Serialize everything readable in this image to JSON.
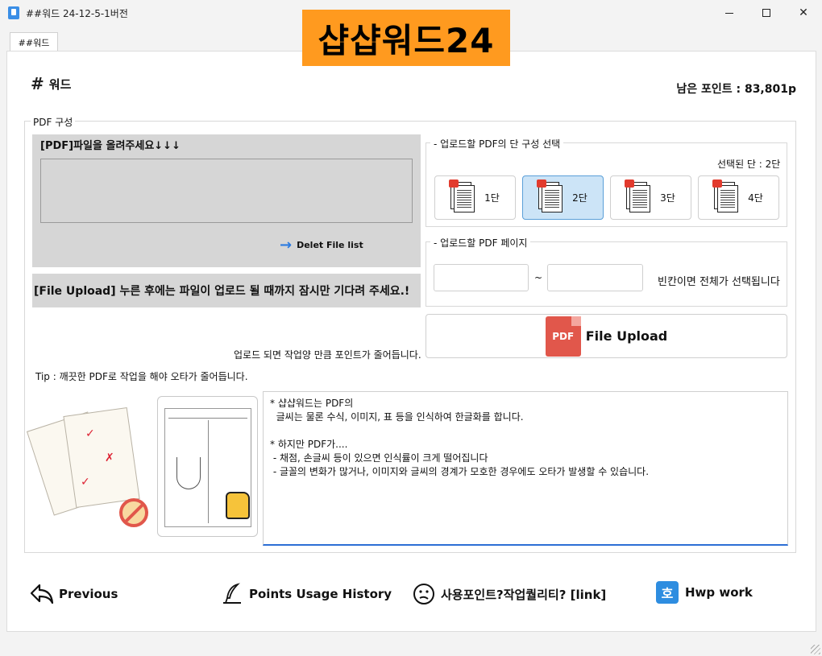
{
  "window": {
    "title": "##워드 24-12-5-1버전"
  },
  "brand": {
    "banner": "샵샵워드24"
  },
  "tab": {
    "label": "##워드"
  },
  "header": {
    "title": "워드",
    "points_label": "남은 포인트 : 83,801p"
  },
  "pdf_section": {
    "label": "PDF 구성",
    "drop_title": "[PDF]파일을 올려주세요↓↓↓",
    "delete_label": "Delet File list",
    "notice": "[File Upload] 누른 후에는 파일이 업로드 될 때까지 잠시만 기다려 주세요.!"
  },
  "columns": {
    "label": "업로드할 PDF의 단 구성 선택",
    "selected_text": "선택된 단 : 2단",
    "options": [
      "1단",
      "2단",
      "3단",
      "4단"
    ],
    "selected_index": 1
  },
  "pages": {
    "label": "업로드할 PDF 페이지",
    "from_value": "",
    "to_value": "",
    "separator": "~",
    "hint": "빈칸이면 전체가 선택됩니다"
  },
  "upload": {
    "icon_text": "PDF",
    "label": "File Upload"
  },
  "deduct_note": "업로드 되면 작업양 만큼 포인트가 줄어듭니다.",
  "tip": "Tip : 깨끗한 PDF로 작업을 해야 오타가 줄어듭니다.",
  "description": "* 샵샵워드는 PDF의\n  글씨는 물론 수식, 이미지, 표 등을 인식하여 한글화를 합니다.\n\n* 하지만 PDF가....\n - 채점, 손글씨 등이 있으면 인식률이 크게 떨어집니다\n - 글꼴의 변화가 많거나, 이미지와 글씨의 경계가 모호한 경우에도 오타가 발생할 수 있습니다.",
  "nav": {
    "previous": "Previous",
    "history": "Points Usage History",
    "link": "사용포인트?작업퀄리티? [link]",
    "hwp": "Hwp work",
    "hwp_icon_text": "호"
  },
  "colors": {
    "brand": "#ff9a1f",
    "accent": "#2c7be0",
    "pdf_red": "#e1574b",
    "selected_bg": "#cce4f7"
  }
}
